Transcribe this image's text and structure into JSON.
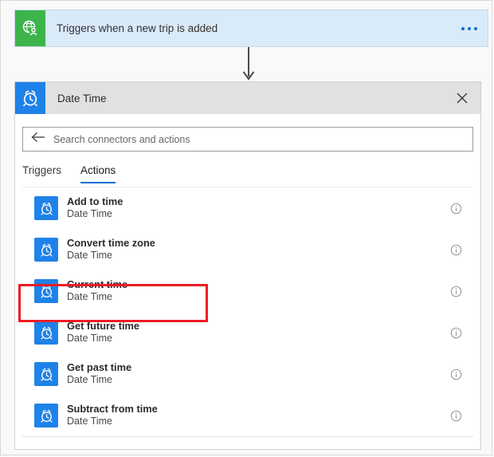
{
  "trigger": {
    "title": "Triggers when a new trip is added",
    "icon": "globe-person-icon",
    "menu_label": "···",
    "icon_color": "#3cb44b",
    "card_color": "#d9eaf9"
  },
  "connector": {
    "icon": "down-arrow-icon"
  },
  "panel": {
    "title": "Date Time",
    "icon": "alarm-clock-icon",
    "close_label": "×",
    "icon_color": "#1f82e8",
    "search": {
      "back_icon": "back-arrow-icon",
      "placeholder": "Search connectors and actions",
      "value": ""
    },
    "tabs": [
      {
        "label": "Triggers",
        "active": false
      },
      {
        "label": "Actions",
        "active": true
      }
    ],
    "active_tab_color": "#0a6ed1",
    "actions": [
      {
        "name": "Add to time",
        "connector": "Date Time",
        "info": "ⓘ",
        "highlighted": false
      },
      {
        "name": "Convert time zone",
        "connector": "Date Time",
        "info": "ⓘ",
        "highlighted": false
      },
      {
        "name": "Current time",
        "connector": "Date Time",
        "info": "ⓘ",
        "highlighted": true
      },
      {
        "name": "Get future time",
        "connector": "Date Time",
        "info": "ⓘ",
        "highlighted": false
      },
      {
        "name": "Get past time",
        "connector": "Date Time",
        "info": "ⓘ",
        "highlighted": false
      },
      {
        "name": "Subtract from time",
        "connector": "Date Time",
        "info": "ⓘ",
        "highlighted": false
      }
    ]
  },
  "annotation": {
    "target": "Current time",
    "color": "#ec1c24"
  }
}
